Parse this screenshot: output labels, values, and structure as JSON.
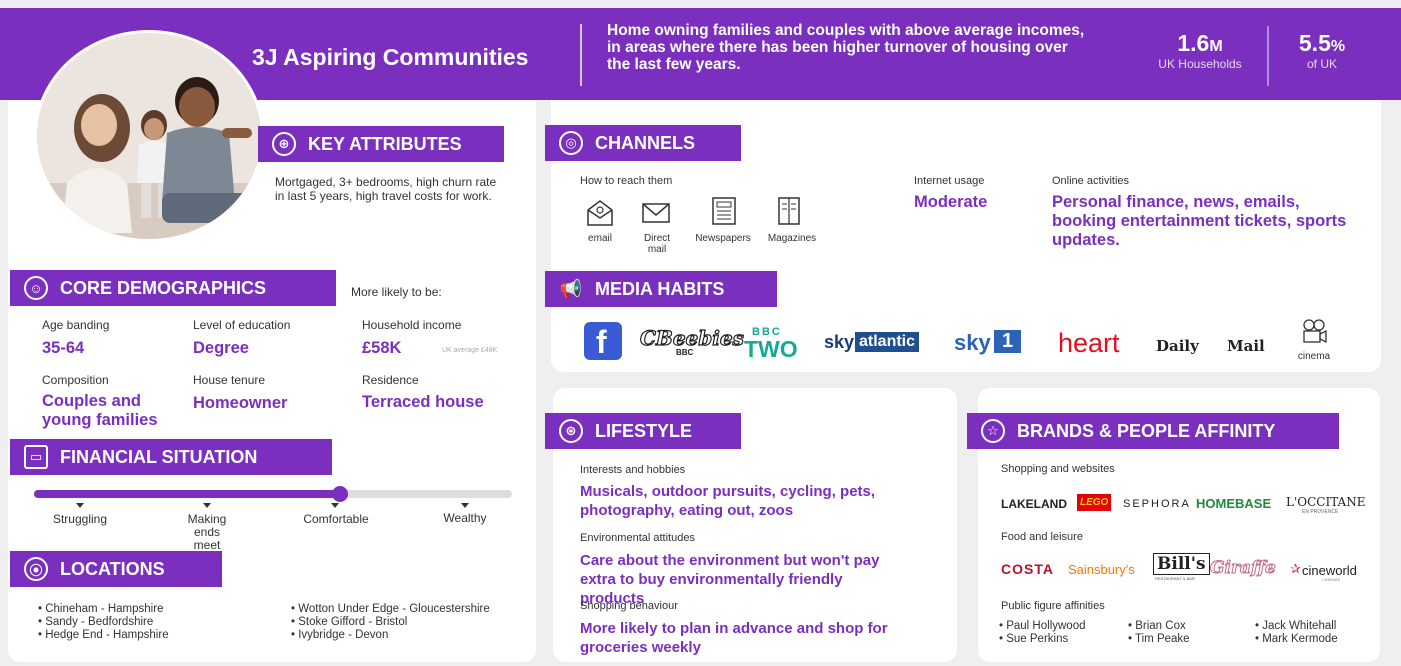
{
  "header": {
    "title": "3J Aspiring Communities",
    "description": "Home owning families and couples with above average incomes, in areas where there has been higher turnover of housing over the last few years.",
    "stats": [
      {
        "value": "1.6",
        "unit": "M",
        "label": "UK Households"
      },
      {
        "value": "5.5",
        "unit": "%",
        "label": "of UK"
      }
    ]
  },
  "key_attributes": {
    "title": "KEY ATTRIBUTES",
    "text": "Mortgaged, 3+ bedrooms, high churn rate in last 5 years, high travel costs for work."
  },
  "core_demographics": {
    "title": "CORE DEMOGRAPHICS",
    "more_likely": "More likely to be:",
    "items": [
      {
        "label": "Age banding",
        "value": "35-64"
      },
      {
        "label": "Level of education",
        "value": "Degree"
      },
      {
        "label": "Household income",
        "value": "£58K",
        "note": "UK average £48K"
      },
      {
        "label": "Composition",
        "value": "Couples and young families"
      },
      {
        "label": "House tenure",
        "value": "Homeowner"
      },
      {
        "label": "Residence",
        "value": "Terraced house"
      }
    ]
  },
  "financial_situation": {
    "title": "FINANCIAL SITUATION",
    "level": 0.64,
    "labels": [
      "Struggling",
      "Making ends meet",
      "Comfortable",
      "Wealthy"
    ]
  },
  "locations": {
    "title": "LOCATIONS",
    "col1": [
      "• Chineham - Hampshire",
      "• Sandy - Bedfordshire",
      "• Hedge End - Hampshire"
    ],
    "col2": [
      "• Wotton Under Edge - Gloucestershire",
      "• Stoke Gifford - Bristol",
      "• Ivybridge - Devon"
    ]
  },
  "channels": {
    "title": "CHANNELS",
    "how_label": "How to reach them",
    "icons": [
      {
        "label": "email",
        "icon": "email-icon"
      },
      {
        "label": "Direct mail",
        "icon": "envelope-icon"
      },
      {
        "label": "Newspapers",
        "icon": "newspaper-icon"
      },
      {
        "label": "Magazines",
        "icon": "magazine-icon"
      }
    ],
    "internet_label": "Internet usage",
    "internet_value": "Moderate",
    "online_label": "Online activities",
    "online_value": "Personal finance, news, emails, booking entertainment tickets, sports updates."
  },
  "media_habits": {
    "title": "MEDIA HABITS",
    "logos": {
      "facebook": "f",
      "cbeebies": "CBeebies",
      "cbeebies_sub": "BBC",
      "bbc": "BBC",
      "two": "TWO",
      "sky_a": "sky",
      "atlantic": "atlantic",
      "sky1_a": "sky",
      "sky1_b": "1",
      "heart": "heart",
      "daily": "Daily",
      "mail": "Mail",
      "cinema": "cinema"
    }
  },
  "lifestyle": {
    "title": "LIFESTYLE",
    "items": [
      {
        "label": "Interests and hobbies",
        "value": "Musicals, outdoor pursuits, cycling, pets, photography, eating out, zoos"
      },
      {
        "label": "Environmental attitudes",
        "value": "Care about the environment but won't pay extra to buy environmentally friendly products"
      },
      {
        "label": "Shopping behaviour",
        "value": "More likely to plan in advance and shop for groceries weekly"
      }
    ]
  },
  "brands": {
    "title": "BRANDS & PEOPLE AFFINITY",
    "shopping_label": "Shopping and websites",
    "shopping": [
      "LAKELAND",
      "LEGO",
      "SEPHORA",
      "HOMEBASE",
      "L'OCCITANE"
    ],
    "occitane_sub": "EN PROVENCE",
    "food_label": "Food and leisure",
    "food": [
      "COSTA",
      "Sainsbury's",
      "Bill's",
      "Giraffe",
      "cineworld"
    ],
    "bills_sub": "RESTAURANT & BAR",
    "cineworld_sub": "CINEMAS",
    "public_label": "Public figure affinities",
    "people": [
      [
        "• Paul Hollywood",
        "• Sue Perkins"
      ],
      [
        "• Brian Cox",
        "• Tim Peake"
      ],
      [
        "• Jack Whitehall",
        "• Mark Kermode"
      ]
    ]
  },
  "colors": {
    "accent": "#7b2fbf",
    "background": "#efeef1",
    "panel": "#ffffff"
  }
}
